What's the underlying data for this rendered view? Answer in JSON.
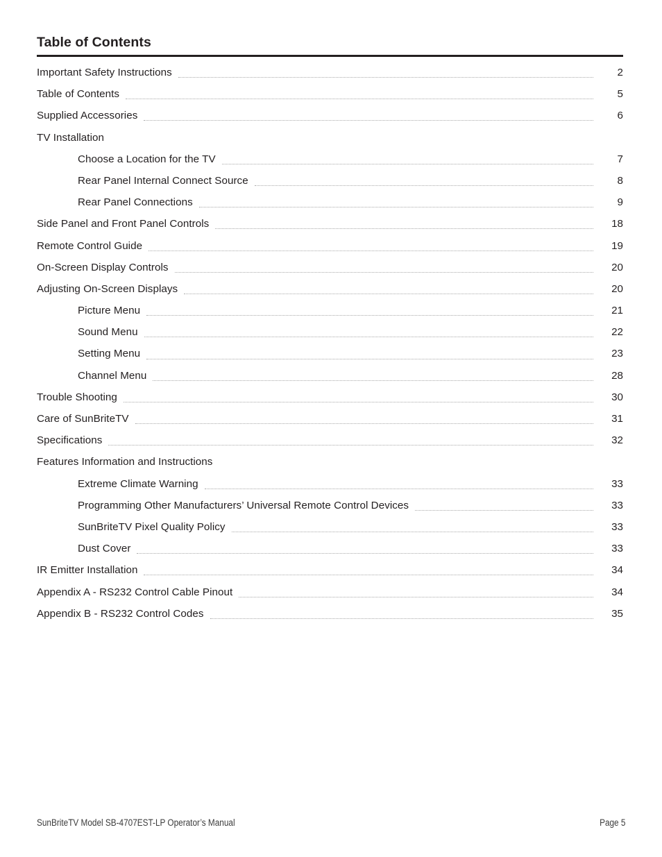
{
  "page": {
    "heading": "Table of Contents",
    "footer_left": "SunBriteTV Model SB-4707EST-LP Operator’s Manual",
    "footer_right": "Page 5",
    "accent_rule_color": "#231f20",
    "text_color": "#231f20",
    "leader_color": "#a9a9a9"
  },
  "toc": {
    "entries": [
      {
        "label": "Important Safety Instructions",
        "page": "2",
        "level": 1,
        "has_leader": true
      },
      {
        "label": "Table of Contents",
        "page": "5",
        "level": 1,
        "has_leader": true
      },
      {
        "label": "Supplied Accessories",
        "page": "6",
        "level": 1,
        "has_leader": true
      },
      {
        "label": "TV Installation",
        "page": "",
        "level": 1,
        "has_leader": false
      },
      {
        "label": "Choose a Location for the TV",
        "page": "7",
        "level": 2,
        "has_leader": true
      },
      {
        "label": "Rear Panel Internal Connect Source",
        "page": "8",
        "level": 2,
        "has_leader": true
      },
      {
        "label": "Rear Panel Connections",
        "page": "9",
        "level": 2,
        "has_leader": true
      },
      {
        "label": "Side Panel and Front Panel Controls",
        "page": "18",
        "level": 1,
        "has_leader": true
      },
      {
        "label": "Remote Control Guide",
        "page": "19",
        "level": 1,
        "has_leader": true
      },
      {
        "label": "On-Screen Display Controls",
        "page": "20",
        "level": 1,
        "has_leader": true
      },
      {
        "label": "Adjusting On-Screen Displays",
        "page": "20",
        "level": 1,
        "has_leader": true
      },
      {
        "label": "Picture Menu",
        "page": "21",
        "level": 2,
        "has_leader": true
      },
      {
        "label": "Sound Menu",
        "page": "22",
        "level": 2,
        "has_leader": true
      },
      {
        "label": "Setting Menu",
        "page": "23",
        "level": 2,
        "has_leader": true
      },
      {
        "label": "Channel Menu",
        "page": "28",
        "level": 2,
        "has_leader": true
      },
      {
        "label": "Trouble Shooting",
        "page": "30",
        "level": 1,
        "has_leader": true
      },
      {
        "label": "Care of SunBriteTV",
        "page": "31",
        "level": 1,
        "has_leader": true
      },
      {
        "label": "Specifications",
        "page": "32",
        "level": 1,
        "has_leader": true
      },
      {
        "label": "Features Information and Instructions",
        "page": "",
        "level": 1,
        "has_leader": false
      },
      {
        "label": "Extreme Climate Warning",
        "page": "33",
        "level": 2,
        "has_leader": true
      },
      {
        "label": "Programming Other Manufacturers’ Universal Remote Control Devices",
        "page": "33",
        "level": 2,
        "has_leader": true
      },
      {
        "label": "SunBriteTV Pixel Quality Policy",
        "page": "33",
        "level": 2,
        "has_leader": true
      },
      {
        "label": "Dust Cover",
        "page": "33",
        "level": 2,
        "has_leader": true
      },
      {
        "label": "IR Emitter Installation",
        "page": "34",
        "level": 1,
        "has_leader": true
      },
      {
        "label": "Appendix A - RS232 Control Cable Pinout",
        "page": "34",
        "level": 1,
        "has_leader": true
      },
      {
        "label": "Appendix B - RS232 Control Codes",
        "page": "35",
        "level": 1,
        "has_leader": true
      }
    ]
  }
}
